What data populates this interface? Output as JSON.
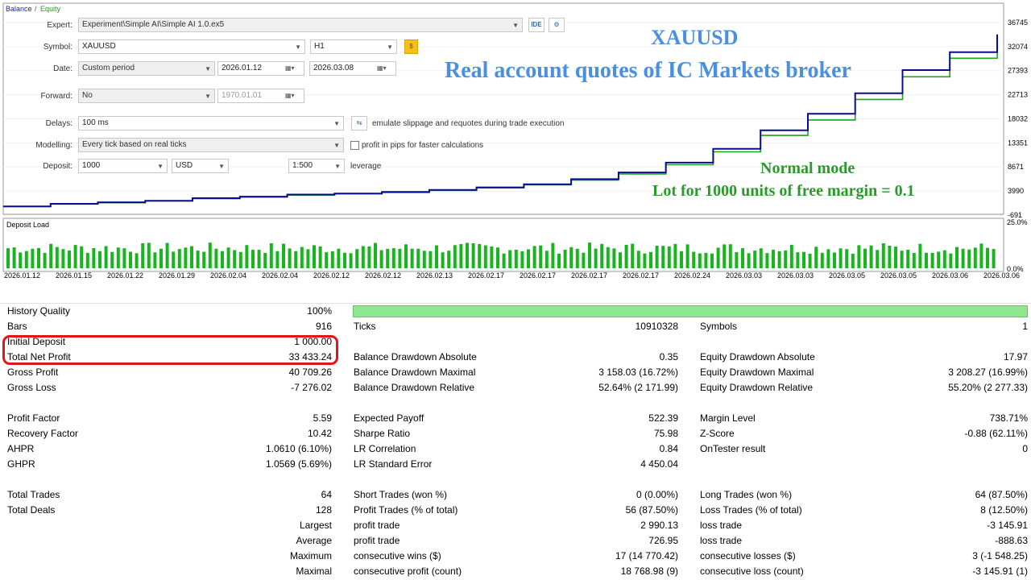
{
  "chart": {
    "legend_balance": "Balance",
    "legend_sep": "/",
    "legend_equity": "Equity",
    "balance_color": "#0b0b8f",
    "equity_color": "#18a318",
    "y_ticks": [
      "36745",
      "32074",
      "27393",
      "22713",
      "18032",
      "13351",
      "8671",
      "3990",
      "-691"
    ],
    "deposit_load_label": "Deposit Load",
    "load_ticks": [
      "25.0%",
      "0.0%"
    ],
    "x_ticks": [
      "2026.01.12",
      "2026.01.15",
      "2026.01.22",
      "2026.01.29",
      "2026.02.04",
      "2026.02.04",
      "2026.02.12",
      "2026.02.12",
      "2026.02.13",
      "2026.02.17",
      "2026.02.17",
      "2026.02.17",
      "2026.02.17",
      "2026.02.24",
      "2026.03.03",
      "2026.03.03",
      "2026.03.05",
      "2026.03.05",
      "2026.03.06",
      "2026.03.06"
    ]
  },
  "chart_data": {
    "type": "line",
    "ylim": [
      -691,
      36745
    ],
    "series": [
      {
        "name": "Balance",
        "values": [
          1000,
          1500,
          1800,
          2100,
          2600,
          2900,
          3300,
          3500,
          3800,
          4200,
          4700,
          5300,
          6300,
          7600,
          9500,
          12200,
          15800,
          19000,
          23000,
          27500,
          31000,
          34433
        ]
      },
      {
        "name": "Equity",
        "values": [
          980,
          1450,
          1700,
          2050,
          2500,
          2800,
          3200,
          3450,
          3700,
          4100,
          4600,
          5200,
          6100,
          7300,
          9100,
          11600,
          14800,
          17800,
          21800,
          26200,
          29800,
          34200
        ]
      }
    ]
  },
  "form": {
    "expert_label": "Expert:",
    "expert_value": "Experiment\\Simple AI\\Simple AI 1.0.ex5",
    "ide_label": "IDE",
    "symbol_label": "Symbol:",
    "symbol_value": "XAUUSD",
    "timeframe_value": "H1",
    "date_label": "Date:",
    "date_mode": "Custom period",
    "date_from": "2026.01.12",
    "date_to": "2026.03.08",
    "forward_label": "Forward:",
    "forward_value": "No",
    "forward_date": "1970.01.01",
    "delays_label": "Delays:",
    "delays_value": "100 ms",
    "delays_note": "emulate slippage and requotes during trade execution",
    "modelling_label": "Modelling:",
    "modelling_value": "Every tick based on real ticks",
    "pips_label": "profit in pips for faster calculations",
    "deposit_label": "Deposit:",
    "deposit_value": "1000",
    "currency_value": "USD",
    "leverage_value": "1:500",
    "leverage_label": "leverage"
  },
  "annotations": {
    "symbol": "XAUUSD",
    "broker": "Real account quotes of IC Markets broker",
    "mode": "Normal mode",
    "lot": "Lot for 1000 units of free margin = 0.1"
  },
  "stats": {
    "history_quality": {
      "label": "History Quality",
      "value": "100%"
    },
    "bars": {
      "label": "Bars",
      "value": "916"
    },
    "ticks": {
      "label": "Ticks",
      "value": "10910328"
    },
    "symbols": {
      "label": "Symbols",
      "value": "1"
    },
    "initial_deposit": {
      "label": "Initial Deposit",
      "value": "1 000.00"
    },
    "total_net_profit": {
      "label": "Total Net Profit",
      "value": "33 433.24"
    },
    "balance_dd_abs": {
      "label": "Balance Drawdown Absolute",
      "value": "0.35"
    },
    "equity_dd_abs": {
      "label": "Equity Drawdown Absolute",
      "value": "17.97"
    },
    "gross_profit": {
      "label": "Gross Profit",
      "value": "40 709.26"
    },
    "balance_dd_max": {
      "label": "Balance Drawdown Maximal",
      "value": "3 158.03 (16.72%)"
    },
    "equity_dd_max": {
      "label": "Equity Drawdown Maximal",
      "value": "3 208.27 (16.99%)"
    },
    "gross_loss": {
      "label": "Gross Loss",
      "value": "-7 276.02"
    },
    "balance_dd_rel": {
      "label": "Balance Drawdown Relative",
      "value": "52.64% (2 171.99)"
    },
    "equity_dd_rel": {
      "label": "Equity Drawdown Relative",
      "value": "55.20% (2 277.33)"
    },
    "profit_factor": {
      "label": "Profit Factor",
      "value": "5.59"
    },
    "expected_payoff": {
      "label": "Expected Payoff",
      "value": "522.39"
    },
    "margin_level": {
      "label": "Margin Level",
      "value": "738.71%"
    },
    "recovery_factor": {
      "label": "Recovery Factor",
      "value": "10.42"
    },
    "sharpe_ratio": {
      "label": "Sharpe Ratio",
      "value": "75.98"
    },
    "z_score": {
      "label": "Z-Score",
      "value": "-0.88 (62.11%)"
    },
    "ahpr": {
      "label": "AHPR",
      "value": "1.0610 (6.10%)"
    },
    "lr_correlation": {
      "label": "LR Correlation",
      "value": "0.84"
    },
    "ontester": {
      "label": "OnTester result",
      "value": "0"
    },
    "ghpr": {
      "label": "GHPR",
      "value": "1.0569 (5.69%)"
    },
    "lr_std_error": {
      "label": "LR Standard Error",
      "value": "4 450.04"
    },
    "total_trades": {
      "label": "Total Trades",
      "value": "64"
    },
    "short_trades": {
      "label": "Short Trades (won %)",
      "value": "0 (0.00%)"
    },
    "long_trades": {
      "label": "Long Trades (won %)",
      "value": "64 (87.50%)"
    },
    "total_deals": {
      "label": "Total Deals",
      "value": "128"
    },
    "profit_trades": {
      "label": "Profit Trades (% of total)",
      "value": "56 (87.50%)"
    },
    "loss_trades": {
      "label": "Loss Trades (% of total)",
      "value": "8 (12.50%)"
    },
    "largest": {
      "label": "Largest",
      "profit_label": "profit trade",
      "profit_value": "2 990.13",
      "loss_label": "loss trade",
      "loss_value": "-3 145.91"
    },
    "average": {
      "label": "Average",
      "profit_label": "profit trade",
      "profit_value": "726.95",
      "loss_label": "loss trade",
      "loss_value": "-888.63"
    },
    "maximum": {
      "label": "Maximum",
      "profit_label": "consecutive wins ($)",
      "profit_value": "17 (14 770.42)",
      "loss_label": "consecutive losses ($)",
      "loss_value": "3 (-1 548.25)"
    },
    "maximal": {
      "label": "Maximal",
      "profit_label": "consecutive profit (count)",
      "profit_value": "18 768.98 (9)",
      "loss_label": "consecutive loss (count)",
      "loss_value": "-3 145.91 (1)"
    }
  }
}
